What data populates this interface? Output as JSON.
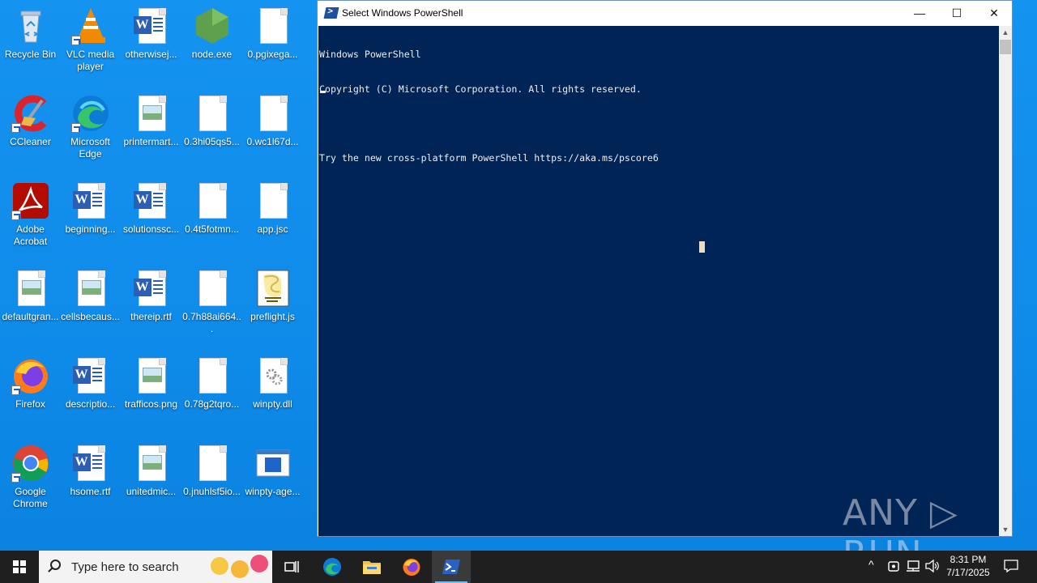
{
  "desktop": {
    "icons": [
      {
        "label": "Recycle Bin",
        "icon": "recycle-bin-icon"
      },
      {
        "label": "VLC media player",
        "icon": "vlc-icon"
      },
      {
        "label": "otherwisej...",
        "icon": "word-document-icon"
      },
      {
        "label": "node.exe",
        "icon": "nodejs-icon"
      },
      {
        "label": "0.pgixega...",
        "icon": "blank-file-icon"
      },
      {
        "label": "CCleaner",
        "icon": "ccleaner-icon"
      },
      {
        "label": "Microsoft Edge",
        "icon": "edge-icon"
      },
      {
        "label": "printermart...",
        "icon": "image-file-icon"
      },
      {
        "label": "0.3hi05qs5...",
        "icon": "blank-file-icon"
      },
      {
        "label": "0.wc1l67d...",
        "icon": "blank-file-icon"
      },
      {
        "label": "Adobe Acrobat",
        "icon": "acrobat-icon"
      },
      {
        "label": "beginning...",
        "icon": "word-document-icon"
      },
      {
        "label": "solutionssc...",
        "icon": "word-document-icon"
      },
      {
        "label": "0.4t5fotmn...",
        "icon": "blank-file-icon"
      },
      {
        "label": "app.jsc",
        "icon": "blank-file-icon"
      },
      {
        "label": "defaultgran...",
        "icon": "image-file-icon"
      },
      {
        "label": "cellsbecaus...",
        "icon": "image-file-icon"
      },
      {
        "label": "thereip.rtf",
        "icon": "word-document-icon"
      },
      {
        "label": "0.7h88ai664...",
        "icon": "blank-file-icon"
      },
      {
        "label": "preflight.js",
        "icon": "script-file-icon"
      },
      {
        "label": "Firefox",
        "icon": "firefox-icon"
      },
      {
        "label": "descriptio...",
        "icon": "word-document-icon"
      },
      {
        "label": "trafficos.png",
        "icon": "image-file-icon"
      },
      {
        "label": "0.78g2tqro...",
        "icon": "blank-file-icon"
      },
      {
        "label": "winpty.dll",
        "icon": "dll-file-icon"
      },
      {
        "label": "Google Chrome",
        "icon": "chrome-icon"
      },
      {
        "label": "hsome.rtf",
        "icon": "word-document-icon"
      },
      {
        "label": "unitedmic...",
        "icon": "image-file-icon"
      },
      {
        "label": "0.jnuhlsf5io...",
        "icon": "blank-file-icon"
      },
      {
        "label": "winpty-age...",
        "icon": "exe-window-icon"
      }
    ]
  },
  "window": {
    "title": "Select Windows PowerShell",
    "minimize": "—",
    "maximize": "☐",
    "close": "✕",
    "console_lines": [
      "Windows PowerShell",
      "Copyright (C) Microsoft Corporation. All rights reserved.",
      "",
      "Try the new cross-platform PowerShell https://aka.ms/pscore6"
    ],
    "scroll_up": "▲",
    "scroll_down": "▼"
  },
  "watermark": "ANY ▷ RUN",
  "taskbar": {
    "search_placeholder": "Type here to search",
    "apps": [
      "task-view-icon",
      "edge-icon",
      "file-explorer-icon",
      "firefox-icon",
      "powershell-icon"
    ],
    "active_app": "powershell-icon",
    "tray": {
      "chevron": "^",
      "time": "8:31 PM",
      "date": "7/17/2025"
    }
  },
  "colors": {
    "desktop_bg": "#1593f0",
    "console_bg": "#012456",
    "console_fg": "#eeedf0",
    "taskbar_bg": "#1f1f1f"
  }
}
